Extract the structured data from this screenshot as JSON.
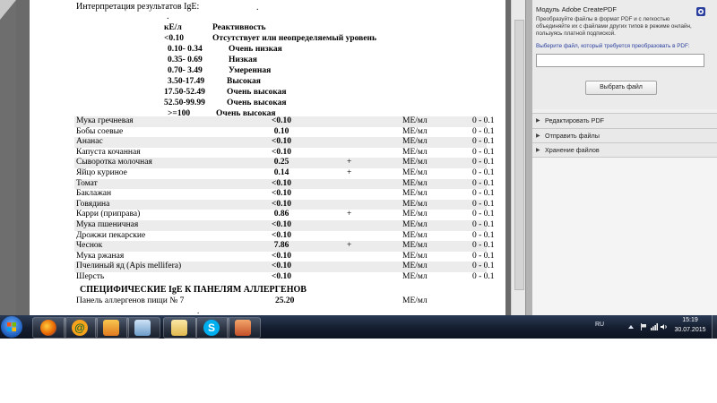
{
  "document": {
    "interpretation_title": "Интерпретация результатов IgE:",
    "interpretation_dot": ".",
    "legend_dot": ".",
    "legend": [
      {
        "range": "кЕ/л",
        "label": "Реактивность"
      },
      {
        "range": "<0.10",
        "label": "Отсутствует или неопределяемый уровень"
      },
      {
        "range": "0.10- 0.34",
        "label": "Очень низкая"
      },
      {
        "range": "0.35- 0.69",
        "label": "Низкая"
      },
      {
        "range": "0.70- 3.49",
        "label": "Умеренная"
      },
      {
        "range": "3.50-17.49",
        "label": "Высокая"
      },
      {
        "range": "17.50-52.49",
        "label": "Очень высокая"
      },
      {
        "range": "52.50-99.99",
        "label": "Очень высокая"
      },
      {
        "range": ">=100",
        "label": "Очень высокая"
      }
    ],
    "results": [
      {
        "name": "Мука гречневая",
        "value": "<0.10",
        "flag": "",
        "unit": "МЕ/мл",
        "ref": "0 - 0.1"
      },
      {
        "name": "Бобы соевые",
        "value": "0.10",
        "flag": "",
        "unit": "МЕ/мл",
        "ref": "0 - 0.1"
      },
      {
        "name": "Ананас",
        "value": "<0.10",
        "flag": "",
        "unit": "МЕ/мл",
        "ref": "0 - 0.1"
      },
      {
        "name": "Капуста кочанная",
        "value": "<0.10",
        "flag": "",
        "unit": "МЕ/мл",
        "ref": "0 - 0.1"
      },
      {
        "name": "Сыворотка молочная",
        "value": "0.25",
        "flag": "+",
        "unit": "МЕ/мл",
        "ref": "0 - 0.1"
      },
      {
        "name": "Яйцо куриное",
        "value": "0.14",
        "flag": "+",
        "unit": "МЕ/мл",
        "ref": "0 - 0.1"
      },
      {
        "name": "Томат",
        "value": "<0.10",
        "flag": "",
        "unit": "МЕ/мл",
        "ref": "0 - 0.1"
      },
      {
        "name": "Баклажан",
        "value": "<0.10",
        "flag": "",
        "unit": "МЕ/мл",
        "ref": "0 - 0.1"
      },
      {
        "name": "Говядина",
        "value": "<0.10",
        "flag": "",
        "unit": "МЕ/мл",
        "ref": "0 - 0.1"
      },
      {
        "name": "Карри (приправа)",
        "value": "0.86",
        "flag": "+",
        "unit": "МЕ/мл",
        "ref": "0 - 0.1"
      },
      {
        "name": "Мука пшеничная",
        "value": "<0.10",
        "flag": "",
        "unit": "МЕ/мл",
        "ref": "0 - 0.1"
      },
      {
        "name": "Дрожжи пекарские",
        "value": "<0.10",
        "flag": "",
        "unit": "МЕ/мл",
        "ref": "0 - 0.1"
      },
      {
        "name": "Чеснок",
        "value": "7.86",
        "flag": "+",
        "unit": "МЕ/мл",
        "ref": "0 - 0.1"
      },
      {
        "name": "Мука ржаная",
        "value": "<0.10",
        "flag": "",
        "unit": "МЕ/мл",
        "ref": "0 - 0.1"
      },
      {
        "name": "Пчелиный яд (Apis mellifera)",
        "value": "<0.10",
        "flag": "",
        "unit": "МЕ/мл",
        "ref": "0 - 0.1"
      },
      {
        "name": "Шерсть",
        "value": "<0.10",
        "flag": "",
        "unit": "МЕ/мл",
        "ref": "0 - 0.1"
      }
    ],
    "section_title": "СПЕЦИФИЧЕСКИЕ IgE К ПАНЕЛЯМ АЛЛЕРГЕНОВ",
    "panel_row": {
      "name": "Панель аллергенов пищи № 7",
      "value": "25.20",
      "unit": "МЕ/мл"
    },
    "bottom_dot": "."
  },
  "side_panel": {
    "title": "Модуль Adobe CreatePDF",
    "description": "Преобразуйте файлы в формат PDF и с легкостью объединяйте их с файлами других типов в режиме онлайн, пользуясь платной подпиской.",
    "prompt": "Выберите файл, который требуется преобразовать в PDF:",
    "button": "Выбрать файл",
    "sections": [
      "Редактировать PDF",
      "Отправить файлы",
      "Хранение файлов"
    ],
    "badge_icon": "adobe-logo-icon",
    "accent_color": "#2b3f9e"
  },
  "taskbar": {
    "apps": [
      "firefox-icon",
      "agent-icon",
      "media-player-icon",
      "network-computer-icon",
      "folder-icon",
      "skype-icon",
      "photo-app-icon"
    ],
    "language": "RU",
    "time": "15:19",
    "date": "30.07.2015"
  }
}
